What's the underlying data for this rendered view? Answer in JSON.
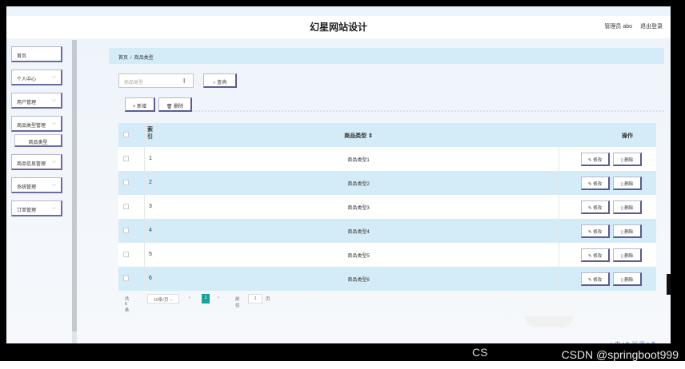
{
  "header": {
    "title": "幻星网站设计",
    "admin_label": "管理员 abo",
    "logout": "退出登录"
  },
  "sidebar": {
    "items": [
      {
        "label": "首页"
      },
      {
        "label": "个人中心"
      },
      {
        "label": "用户管理"
      },
      {
        "label": "商品类型管理"
      },
      {
        "label": "商品信息管理"
      },
      {
        "label": "系统管理"
      },
      {
        "label": "订单管理"
      }
    ],
    "sub_active": "商品类型"
  },
  "breadcrumb": {
    "home": "首页",
    "sep": "/",
    "current": "商品类型"
  },
  "search": {
    "placeholder": "商品类型",
    "button": "查询",
    "search_icon": "search-icon"
  },
  "toolbar": {
    "add": "+ 新增",
    "delete": "删除"
  },
  "table": {
    "headers": {
      "index": "索引",
      "name": "商品类型 ⇕",
      "ops": "操作"
    },
    "rows": [
      {
        "index": "1",
        "name": "商品类型1"
      },
      {
        "index": "2",
        "name": "商品类型2"
      },
      {
        "index": "3",
        "name": "商品类型3"
      },
      {
        "index": "4",
        "name": "商品类型4"
      },
      {
        "index": "5",
        "name": "商品类型5"
      },
      {
        "index": "6",
        "name": "商品类型6"
      }
    ],
    "edit_label": "修改",
    "delete_label": "删除"
  },
  "pager": {
    "total": "共 6 条",
    "page_size": "10条/页",
    "prev": "‹",
    "current": "1",
    "next": "›",
    "goto_label": "前往",
    "goto_value": "1",
    "page_unit": "页"
  },
  "footer": {
    "watermark": "CSDN @springboot999",
    "cs_mark": "CS"
  },
  "colors": {
    "accent": "#1aa39c",
    "row_alt": "#d4ecf8",
    "button_border": "#5b5b90"
  }
}
